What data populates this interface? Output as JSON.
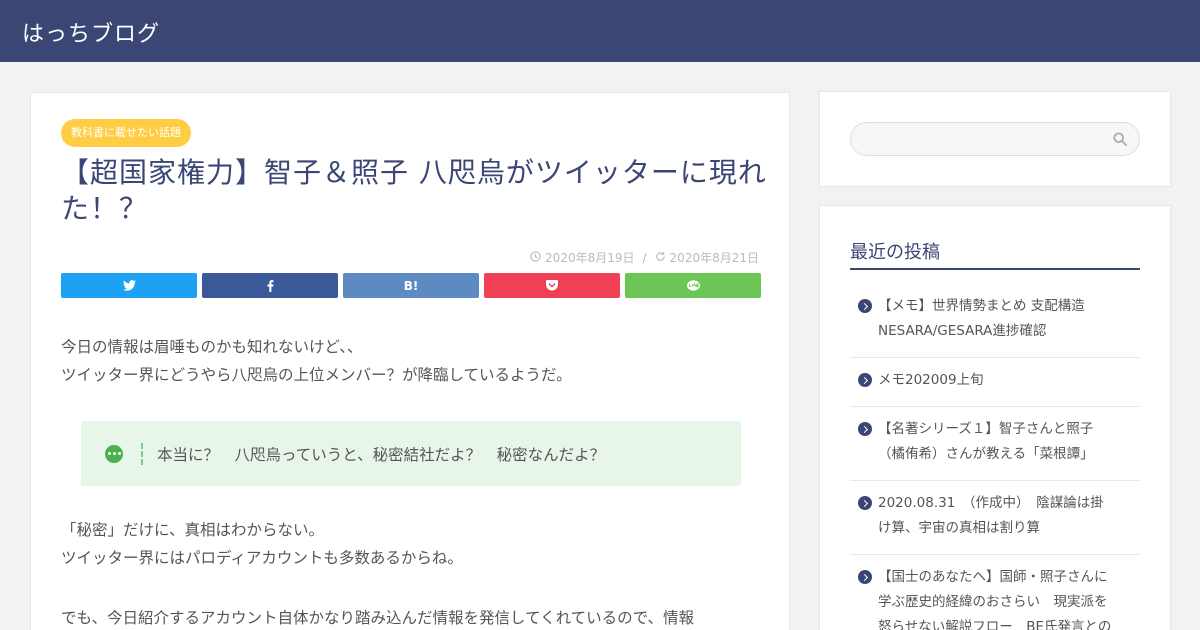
{
  "header": {
    "site_title": "はっちブログ"
  },
  "article": {
    "category": "教科書に載せたい話題",
    "title": "【超国家権力】智子＆照子 八咫烏がツイッターに現れた！？",
    "published": "2020年8月19日",
    "updated": "2020年8月21日",
    "date_separator": "/",
    "share": {
      "hatena_label": "B!"
    },
    "paragraph1_line1": "今日の情報は眉唾ものかも知れないけど、、",
    "paragraph1_line2": "ツイッター界にどうやら八咫烏の上位メンバー？が降臨しているようだ。",
    "speech_text": "本当に？　八咫烏っていうと、秘密結社だよ？　秘密なんだよ？",
    "paragraph2_line1": "「秘密」だけに、真相はわからない。",
    "paragraph2_line2": "ツイッター界にはパロディアカウントも多数あるからね。",
    "paragraph3_line1": "でも、今日紹介するアカウント自体かなり踏み込んだ情報を発信してくれているので、情報"
  },
  "sidebar": {
    "search": {
      "placeholder": ""
    },
    "recent_title": "最近の投稿",
    "recent_posts": [
      {
        "line1": "【メモ】世界情勢まとめ 支配構造",
        "line2": "NESARA/GESARA進捗確認"
      },
      {
        "line1": "メモ202009上旬",
        "line2": ""
      },
      {
        "line1": "【名著シリーズ１】智子さんと照子",
        "line2": "（橘侑希）さんが教える「菜根譚」"
      },
      {
        "line1": "2020.08.31　（作成中）　陰謀論は掛",
        "line2": "け算、宇宙の真相は割り算"
      },
      {
        "line1": "【国士のあなたへ】国師・照子さんに",
        "line2": "学ぶ歴史的経緯のおさらい　現実派を",
        "line3": "怒らせない解説フロー　BE氏発言との"
      }
    ]
  },
  "colors": {
    "header_bg": "#3b4675",
    "category_badge": "#ffcd44",
    "twitter": "#1da1f2",
    "facebook": "#3b5998",
    "hatena": "#5d8ac1",
    "pocket": "#ef4056",
    "line": "#6cc655",
    "speech_bg": "#e8f6e9"
  }
}
